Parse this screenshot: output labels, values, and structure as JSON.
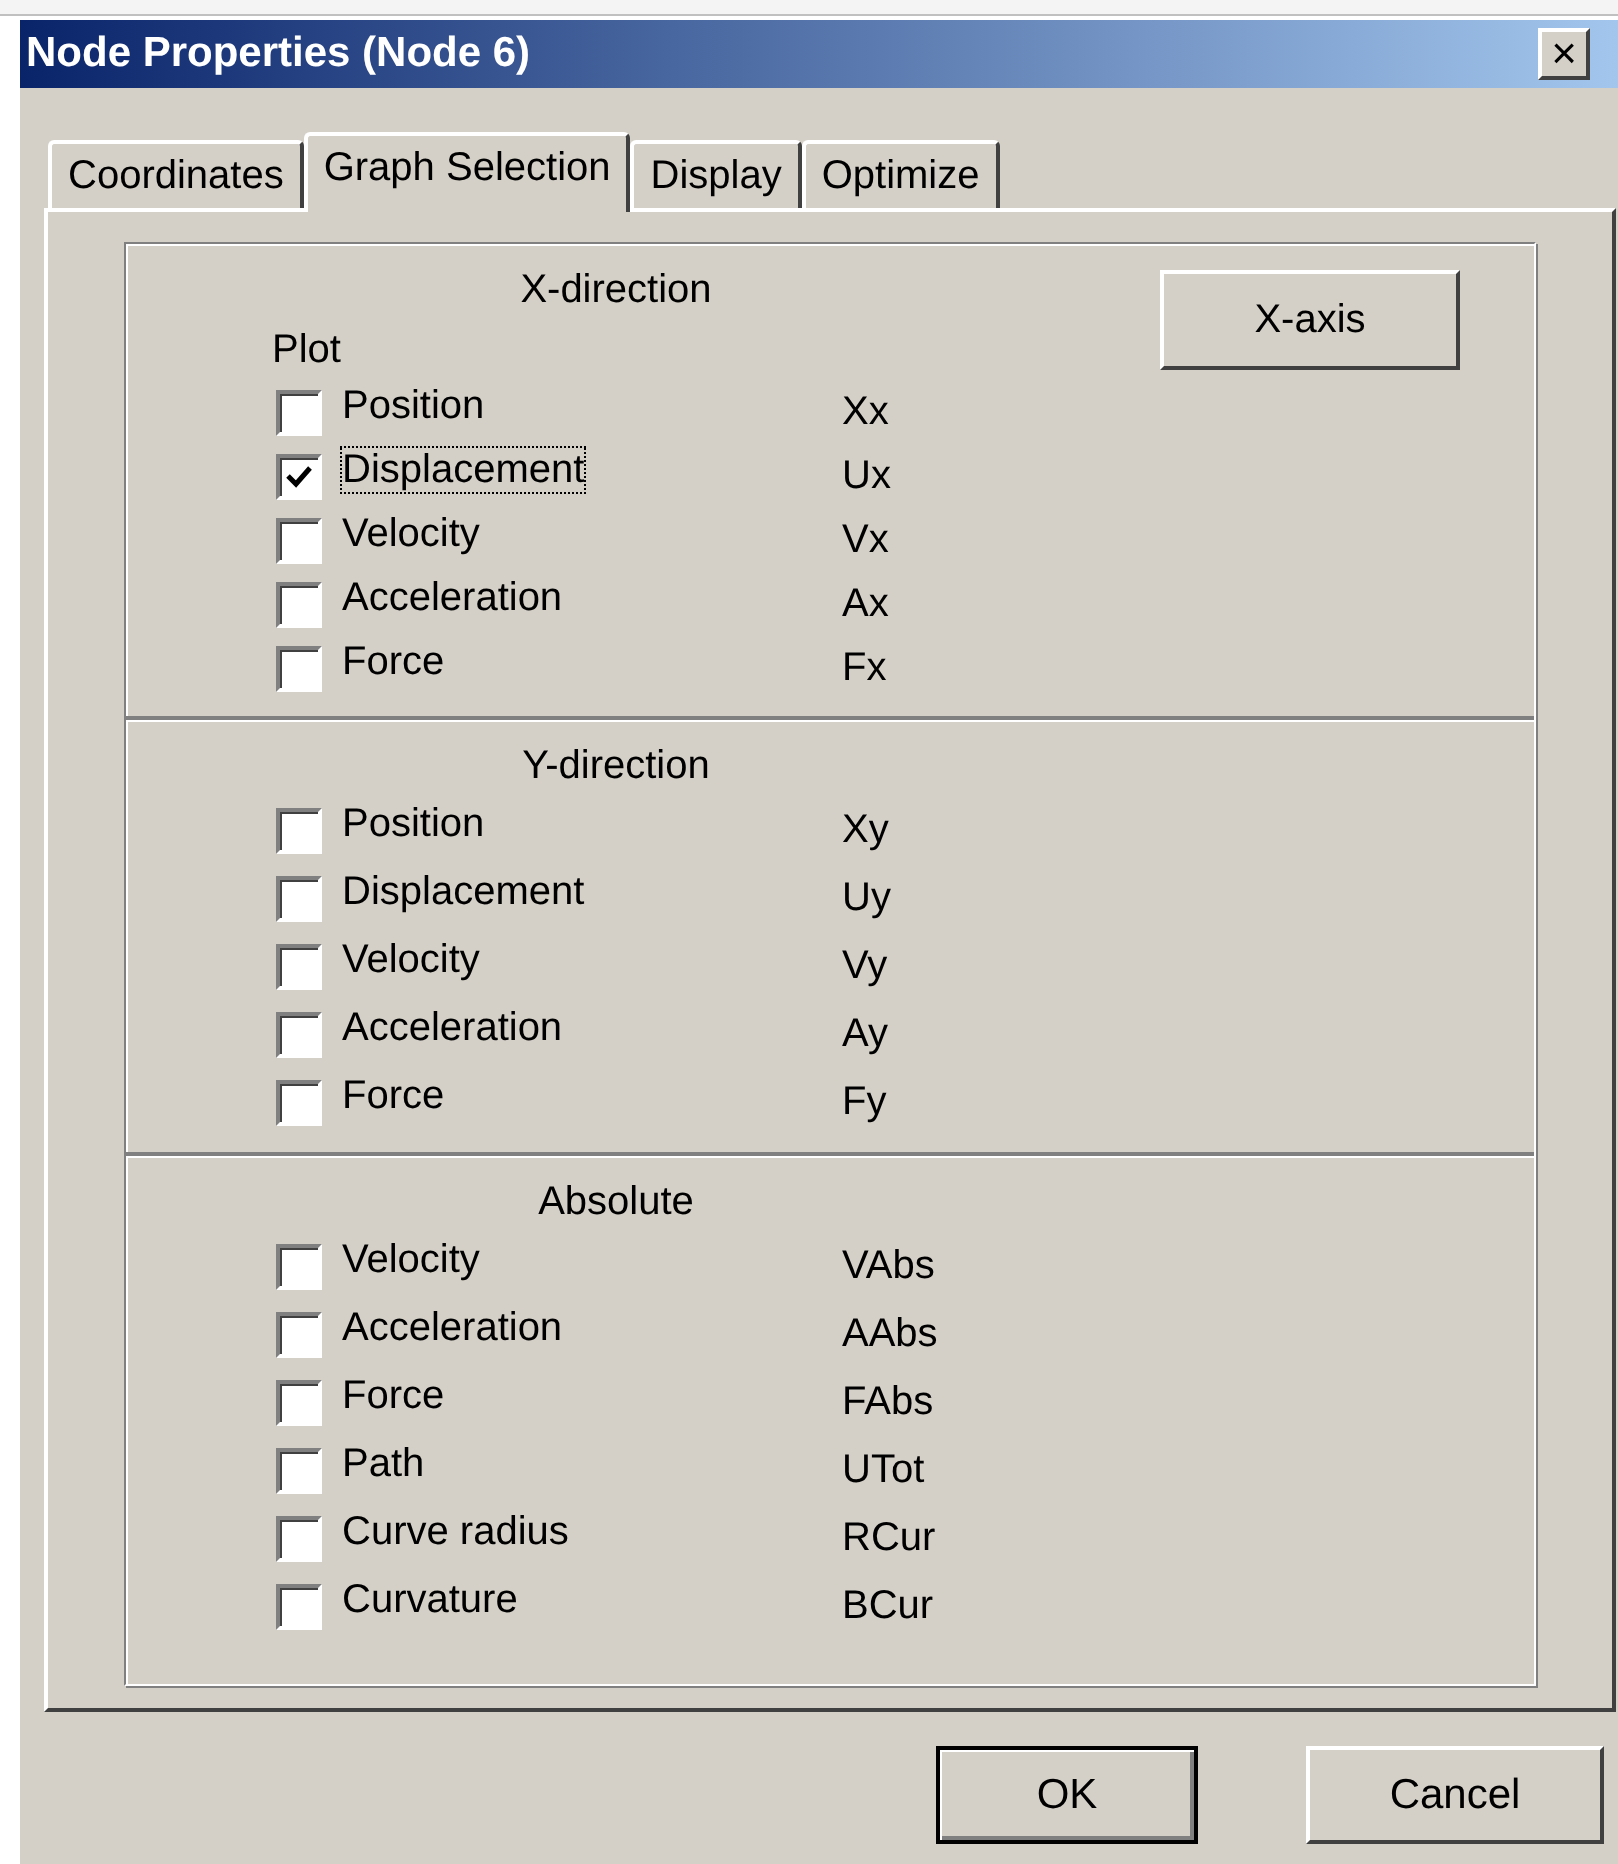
{
  "window": {
    "title": "Node Properties (Node 6)",
    "close": "×"
  },
  "tabs": [
    {
      "label": "Coordinates",
      "selected": false
    },
    {
      "label": "Graph Selection",
      "selected": true
    },
    {
      "label": "Display",
      "selected": false
    },
    {
      "label": "Optimize",
      "selected": false
    }
  ],
  "axis_button": "X-axis",
  "sections": [
    {
      "title": "X-direction",
      "subtitle": "Plot",
      "items": [
        {
          "label": "Position",
          "code": "Xx",
          "checked": false,
          "focused": false
        },
        {
          "label": "Displacement",
          "code": "Ux",
          "checked": true,
          "focused": true
        },
        {
          "label": "Velocity",
          "code": "Vx",
          "checked": false,
          "focused": false
        },
        {
          "label": "Acceleration",
          "code": "Ax",
          "checked": false,
          "focused": false
        },
        {
          "label": "Force",
          "code": "Fx",
          "checked": false,
          "focused": false
        }
      ]
    },
    {
      "title": "Y-direction",
      "items": [
        {
          "label": "Position",
          "code": "Xy",
          "checked": false,
          "focused": false
        },
        {
          "label": "Displacement",
          "code": "Uy",
          "checked": false,
          "focused": false
        },
        {
          "label": "Velocity",
          "code": "Vy",
          "checked": false,
          "focused": false
        },
        {
          "label": "Acceleration",
          "code": "Ay",
          "checked": false,
          "focused": false
        },
        {
          "label": "Force",
          "code": "Fy",
          "checked": false,
          "focused": false
        }
      ]
    },
    {
      "title": "Absolute",
      "items": [
        {
          "label": "Velocity",
          "code": "VAbs",
          "checked": false,
          "focused": false
        },
        {
          "label": "Acceleration",
          "code": "AAbs",
          "checked": false,
          "focused": false
        },
        {
          "label": "Force",
          "code": "FAbs",
          "checked": false,
          "focused": false
        },
        {
          "label": "Path",
          "code": "UTot",
          "checked": false,
          "focused": false
        },
        {
          "label": "Curve radius",
          "code": "RCur",
          "checked": false,
          "focused": false
        },
        {
          "label": "Curvature",
          "code": "BCur",
          "checked": false,
          "focused": false
        }
      ]
    }
  ],
  "buttons": [
    {
      "label": "OK",
      "default": true
    },
    {
      "label": "Cancel",
      "default": false
    }
  ]
}
